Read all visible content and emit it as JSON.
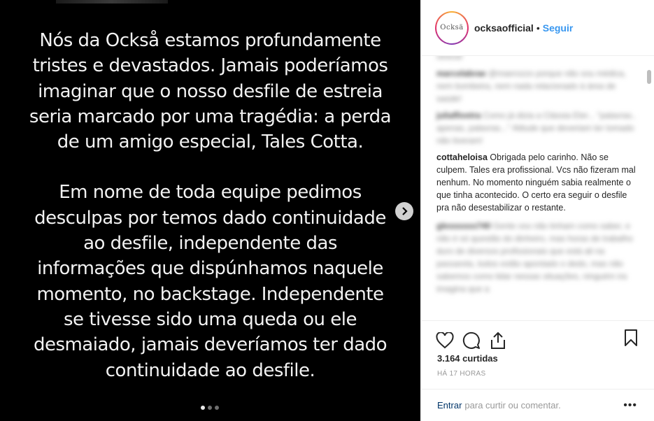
{
  "post": {
    "paragraph1": [
      "Nós da Också estamos profundamente",
      "tristes e devastados. Jamais poderíamos",
      "imaginar que o nosso desfile de estreia",
      "seria marcado por uma tragédia: a perda",
      "de um amigo especial, Tales Cotta."
    ],
    "paragraph2": [
      "Em nome de toda equipe pedimos",
      "desculpas por temos dado continuidade",
      "ao desfile, independente das",
      "informações que dispúnhamos naquele",
      "momento, no backstage. Independente",
      "se tivesse sido uma queda ou ele",
      "desmaiado, jamais deveríamos ter dado",
      "continuidade ao desfile."
    ],
    "carousel": {
      "total": 3,
      "active_index": 0
    }
  },
  "header": {
    "avatar_text": "Ocksä",
    "username": "ocksaofficial",
    "separator": "•",
    "follow_label": "Seguir"
  },
  "comments": {
    "blurred_top": [
      {
        "user": "",
        "text": "rerecer"
      },
      {
        "user": "marcelabrae",
        "text": "@maerozzo porque não sou médica, nem bombeira, nem nada relacionado à área de saúde!"
      },
      {
        "user": "juliaflivetra",
        "text": "Como já dizia a Clássia Eler... \"palavras.. apenas, palavras...\" Atitude que deveriam ter tomado não tiveram!"
      }
    ],
    "clear": {
      "user": "cottaheloisa",
      "text": "Obrigada pelo carinho. Não se culpem. Tales era profissional. Vcs não fizeram mal nenhum. No momento ninguém sabia realmente o que tinha acontecido. O certo era seguir o desfile pra não desestabilizar o restante."
    },
    "blurred_bottom": [
      {
        "user": "glessssss740",
        "text": "Gente oss não tinham como saber, e não é só questão do dinheiro, mas horas de trabalho duro de diversos profissionais que está ali na passarela, todos estão apontado o dedo, mas não sabemos como lidar nessas situações, ninguém ira imagina que a"
      }
    ]
  },
  "actions": {
    "likes": "3.164 curtidas",
    "time": "HÁ 17 HORAS",
    "login_label": "Entrar",
    "login_rest": "para curtir ou comentar.",
    "more": "•••"
  }
}
